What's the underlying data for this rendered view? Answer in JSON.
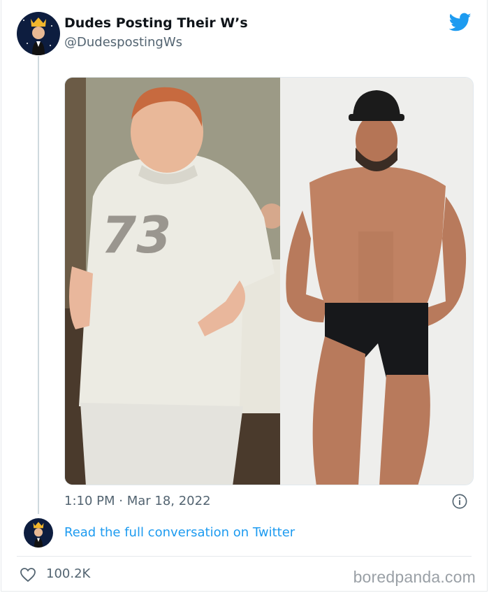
{
  "tweet": {
    "display_name": "Dudes Posting Their W’s",
    "handle": "@DudespostingWs",
    "timestamp": "1:10 PM · Mar 18, 2022",
    "read_full_conversation": "Read the full conversation on Twitter",
    "likes": "100.2K",
    "jersey_number": "73"
  },
  "watermark": "boredpanda.com",
  "colors": {
    "link": "#1d9bf0",
    "secondary_text": "#536471",
    "twitter_blue": "#1d9bf0"
  },
  "icons": [
    "twitter-bird-icon",
    "info-icon",
    "heart-icon"
  ]
}
